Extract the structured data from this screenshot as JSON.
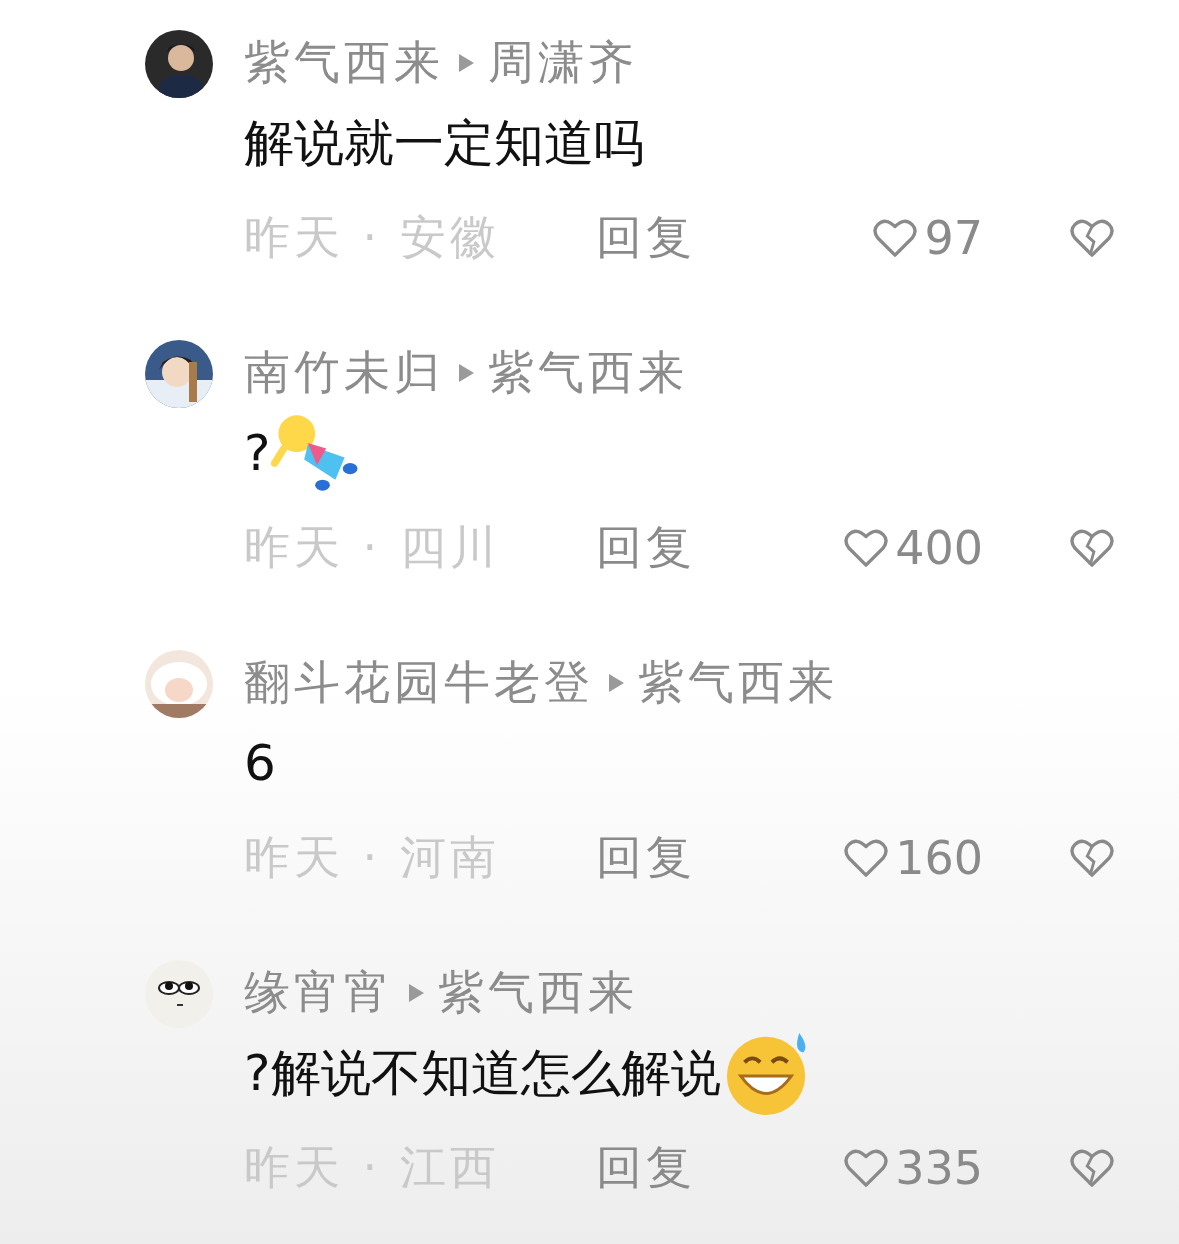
{
  "comments": [
    {
      "author": "紫气西来",
      "reply_to": "周潇齐",
      "text": "解说就一定知道吗",
      "meta": "昨天 · 安徽",
      "reply": "回复",
      "likes": "97"
    },
    {
      "author": "南竹未归",
      "reply_to": "紫气西来",
      "text": "?",
      "sticker": {
        "kind": "figure"
      },
      "meta": "昨天 · 四川",
      "reply": "回复",
      "likes": "400"
    },
    {
      "author": "翻斗花园牛老登",
      "reply_to": "紫气西来",
      "text": "6",
      "meta": "昨天 · 河南",
      "reply": "回复",
      "likes": "160"
    },
    {
      "author": "缘宵宵",
      "reply_to": "紫气西来",
      "text": "?解说不知道怎么解说",
      "sticker": {
        "kind": "grin"
      },
      "meta": "昨天 · 江西",
      "reply": "回复",
      "likes": "335"
    }
  ]
}
